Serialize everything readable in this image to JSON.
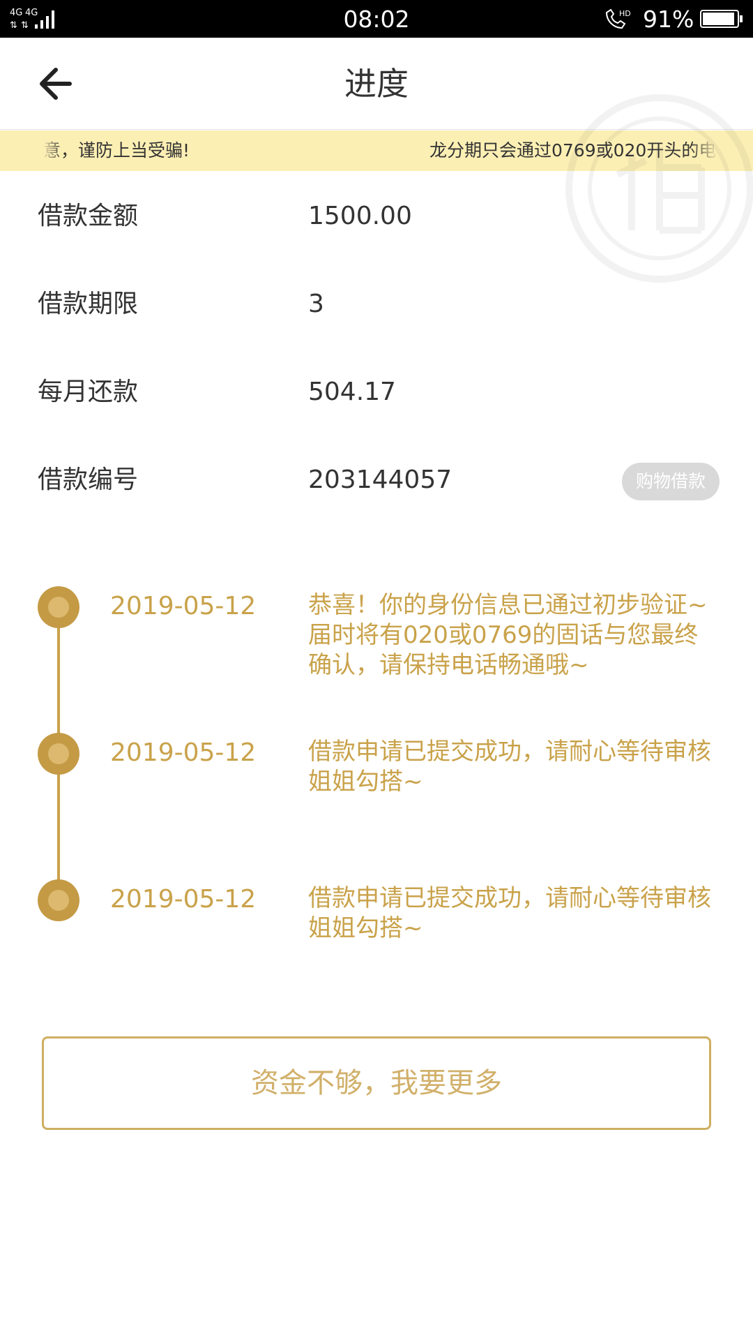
{
  "status_bar": {
    "network": "4G 4G",
    "time": "08:02",
    "battery": "91%"
  },
  "header": {
    "title": "进度"
  },
  "notice": {
    "left_fragment": "意，谨防上当受骗!",
    "right_fragment": "龙分期只会通过0769或020开头的电"
  },
  "loan_info": [
    {
      "label": "借款金额",
      "value": "1500.00"
    },
    {
      "label": "借款期限",
      "value": "3"
    },
    {
      "label": "每月还款",
      "value": "504.17"
    },
    {
      "label": "借款编号",
      "value": "203144057"
    }
  ],
  "loan_type_badge": "购物借款",
  "timeline": [
    {
      "date": "2019-05-12",
      "text": "恭喜！你的身份信息已通过初步验证~届时将有020或0769的固话与您最终确认，请保持电话畅通哦~"
    },
    {
      "date": "2019-05-12",
      "text": "借款申请已提交成功，请耐心等待审核姐姐勾搭~"
    },
    {
      "date": "2019-05-12",
      "text": "借款申请已提交成功，请耐心等待审核姐姐勾搭~"
    }
  ],
  "action_button": {
    "label": "资金不够，我要更多"
  },
  "colors": {
    "accent": "#c9a24a",
    "notice_bg": "#fcefb4",
    "badge_bg": "#d9d9d9"
  }
}
